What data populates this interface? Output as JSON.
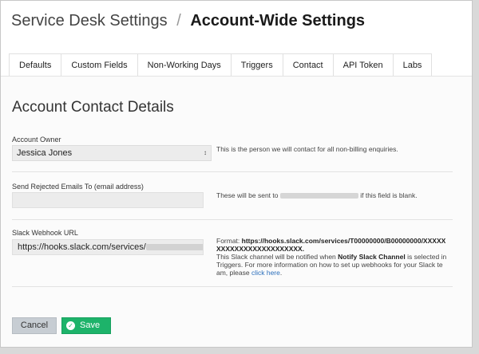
{
  "header": {
    "crumb": "Service Desk Settings",
    "separator": "/",
    "current": "Account-Wide Settings"
  },
  "tabs": [
    {
      "label": "Defaults"
    },
    {
      "label": "Custom Fields"
    },
    {
      "label": "Non-Working Days"
    },
    {
      "label": "Triggers"
    },
    {
      "label": "Contact",
      "active": true
    },
    {
      "label": "API Token"
    },
    {
      "label": "Labs"
    }
  ],
  "section_title": "Account Contact Details",
  "account_owner": {
    "label": "Account Owner",
    "selected": "Jessica Jones",
    "help": "This is the person we will contact for all non-billing enquiries."
  },
  "rejected_emails": {
    "label": "Send Rejected Emails To (email address)",
    "value": "",
    "help_prefix": "These will be sent to",
    "help_suffix": "if this field is blank."
  },
  "slack": {
    "label": "Slack Webhook URL",
    "value_visible": "https://hooks.slack.com/services/",
    "format_prefix": "Format:",
    "format_url_line1": "https://hooks.slack.com/services/T00000000/B00000000/XXXXX",
    "format_url_line2": "XXXXXXXXXXXXXXXXXXX.",
    "help_line3_a": "This Slack channel will be notified when",
    "help_line3_bold": "Notify Slack Channel",
    "help_line3_b": "is selected in",
    "help_line4": "Triggers. For more information on how to set up webhooks for your Slack te",
    "help_line5_a": "am, please",
    "help_line5_link": "click here",
    "help_line5_b": "."
  },
  "buttons": {
    "cancel": "Cancel",
    "save": "Save"
  },
  "colors": {
    "save_green": "#1db36a",
    "cancel_gray": "#c7cdd3",
    "link_blue": "#2a6ebb"
  }
}
